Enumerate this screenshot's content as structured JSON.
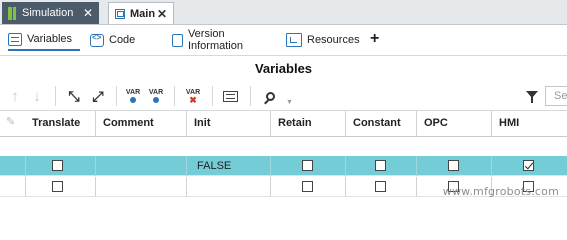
{
  "doc_tabs": [
    {
      "label": "Simulation",
      "icon": "simulation-icon",
      "close": "✕"
    },
    {
      "label": "Main",
      "icon": "main-icon",
      "close": "✕"
    }
  ],
  "sub_tabs": [
    {
      "label": "Variables",
      "icon": "grid-icon"
    },
    {
      "label": "Code",
      "icon": "code-icon"
    },
    {
      "label": "Version Information",
      "icon": "document-icon"
    },
    {
      "label": "Resources",
      "icon": "resources-icon"
    }
  ],
  "add_tab": "+",
  "panel_title": "Variables",
  "toolbar": {
    "var_label": "VAR",
    "search_placeholder": "Se"
  },
  "columns": [
    "Translate",
    "Comment",
    "Init",
    "Retain",
    "Constant",
    "OPC",
    "HMI"
  ],
  "rows": [
    {
      "selected": true,
      "translate": false,
      "comment": "",
      "init": "FALSE",
      "retain": false,
      "constant": false,
      "opc": false,
      "hmi": true
    },
    {
      "selected": false,
      "translate": false,
      "comment": "",
      "init": "",
      "retain": false,
      "constant": false,
      "opc": false,
      "hmi": false
    }
  ],
  "watermark": "www.mfgrobots.com",
  "colors": {
    "selected_row": "#74cdd6",
    "accent": "#2b74b8",
    "sim_tab": "#4c5b69"
  }
}
